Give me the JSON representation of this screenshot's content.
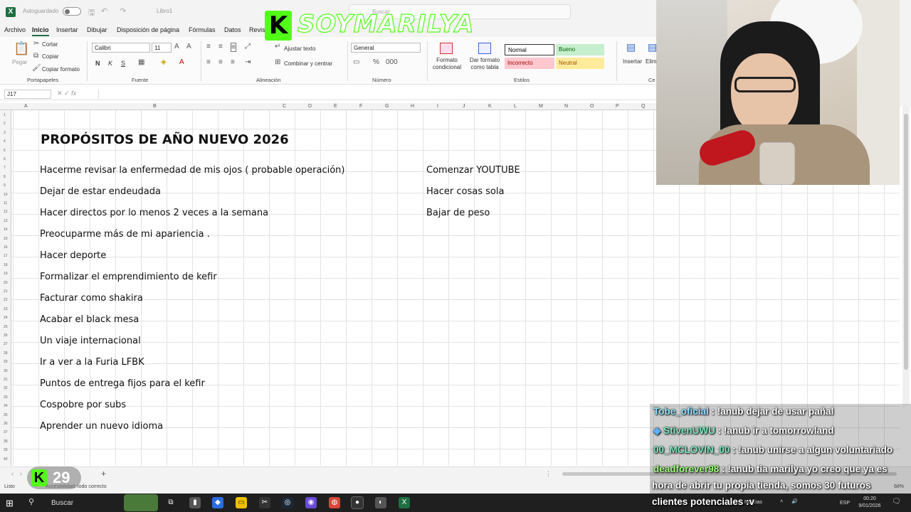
{
  "titlebar": {
    "autosave_label": "Autoguardado",
    "doc_title": "Libro1",
    "search_placeholder": "Buscar"
  },
  "brand": {
    "logo_letter": "K",
    "name": "SOYMARILYA"
  },
  "ribbon_tabs": [
    "Archivo",
    "Inicio",
    "Insertar",
    "Dibujar",
    "Disposición de página",
    "Fórmulas",
    "Datos",
    "Revis"
  ],
  "ribbon": {
    "clipboard": {
      "paste": "Pegar",
      "cut": "Cortar",
      "copy": "Copiar",
      "format_painter": "Copiar formato",
      "label": "Portapapeles"
    },
    "font": {
      "name": "Calibri",
      "size": "11",
      "bold": "N",
      "italic": "K",
      "underline": "S",
      "label": "Fuente"
    },
    "alignment": {
      "wrap": "Ajustar texto",
      "merge": "Combinar y centrar",
      "label": "Alineación"
    },
    "number": {
      "format": "General",
      "label": "Número"
    },
    "styles": {
      "conditional": "Formato condicional",
      "as_table": "Dar formato como tabla",
      "normal": "Normal",
      "bueno": "Bueno",
      "incorrecto": "Incorrecto",
      "neutral": "Neutral",
      "label": "Estilos"
    },
    "cells": {
      "insert": "Insertar",
      "delete": "Elim",
      "label": "Ce"
    }
  },
  "formula_bar": {
    "namebox": "J17",
    "fx": "fx"
  },
  "columns": [
    "A",
    "B",
    "C",
    "D",
    "E",
    "F",
    "G",
    "H",
    "I",
    "J",
    "K",
    "L",
    "M",
    "N",
    "O",
    "P",
    "Q"
  ],
  "sheet": {
    "title": "PROPÓSITOS DE AÑO NUEVO 2026",
    "col_b": [
      "Hacerme revisar la enfermedad de mis ojos ( probable operación)",
      "Dejar de estar endeudada",
      "Hacer directos por lo menos  2 veces a la semana",
      "Preocuparme más de mi apariencia .",
      "Hacer deporte",
      "Formalizar el emprendimiento de kefir",
      "Facturar como shakira",
      "Acabar el black mesa",
      "Un viaje internacional",
      "Ir a ver a la Furia LFBK",
      "Puntos de entrega fijos para el kefir",
      "Cospobre por subs",
      "Aprender un nuevo idioma"
    ],
    "col_i": [
      "Comenzar YOUTUBE",
      "Hacer cosas sola",
      "Bajar de peso"
    ]
  },
  "statusbar": {
    "ready": "Listo",
    "accessibility": "Accesibilidad: todo correcto",
    "zoom": "68%"
  },
  "kick_badge": {
    "letter": "K",
    "count": "29"
  },
  "chat": [
    {
      "user": "Tobe_oficial",
      "message": ": !anub dejar de usar pañal",
      "color": "#8fe3ff"
    },
    {
      "user": "StivenUWU",
      "message": ": !anub ir a tomorrowland",
      "color": "#7fe8c0",
      "badge": "gem-icon"
    },
    {
      "user": "00_MCLOVIN_00",
      "message": ": !anub unirse a algun voluntariado",
      "color": "#7fe8c0"
    },
    {
      "user": "deadforever98",
      "message": ": !anub tia marilya yo creo que ya es",
      "color": "#9cff7a"
    },
    {
      "user": "",
      "message": "hora de abrir tu propia tienda, somos 30 futuros"
    },
    {
      "user": "",
      "message": "clientes potenciales :v"
    }
  ],
  "taskbar": {
    "search_label": "Buscar",
    "lang": "ESP",
    "time": "00:20",
    "date": "9/01/2026",
    "news": "Noticias"
  }
}
